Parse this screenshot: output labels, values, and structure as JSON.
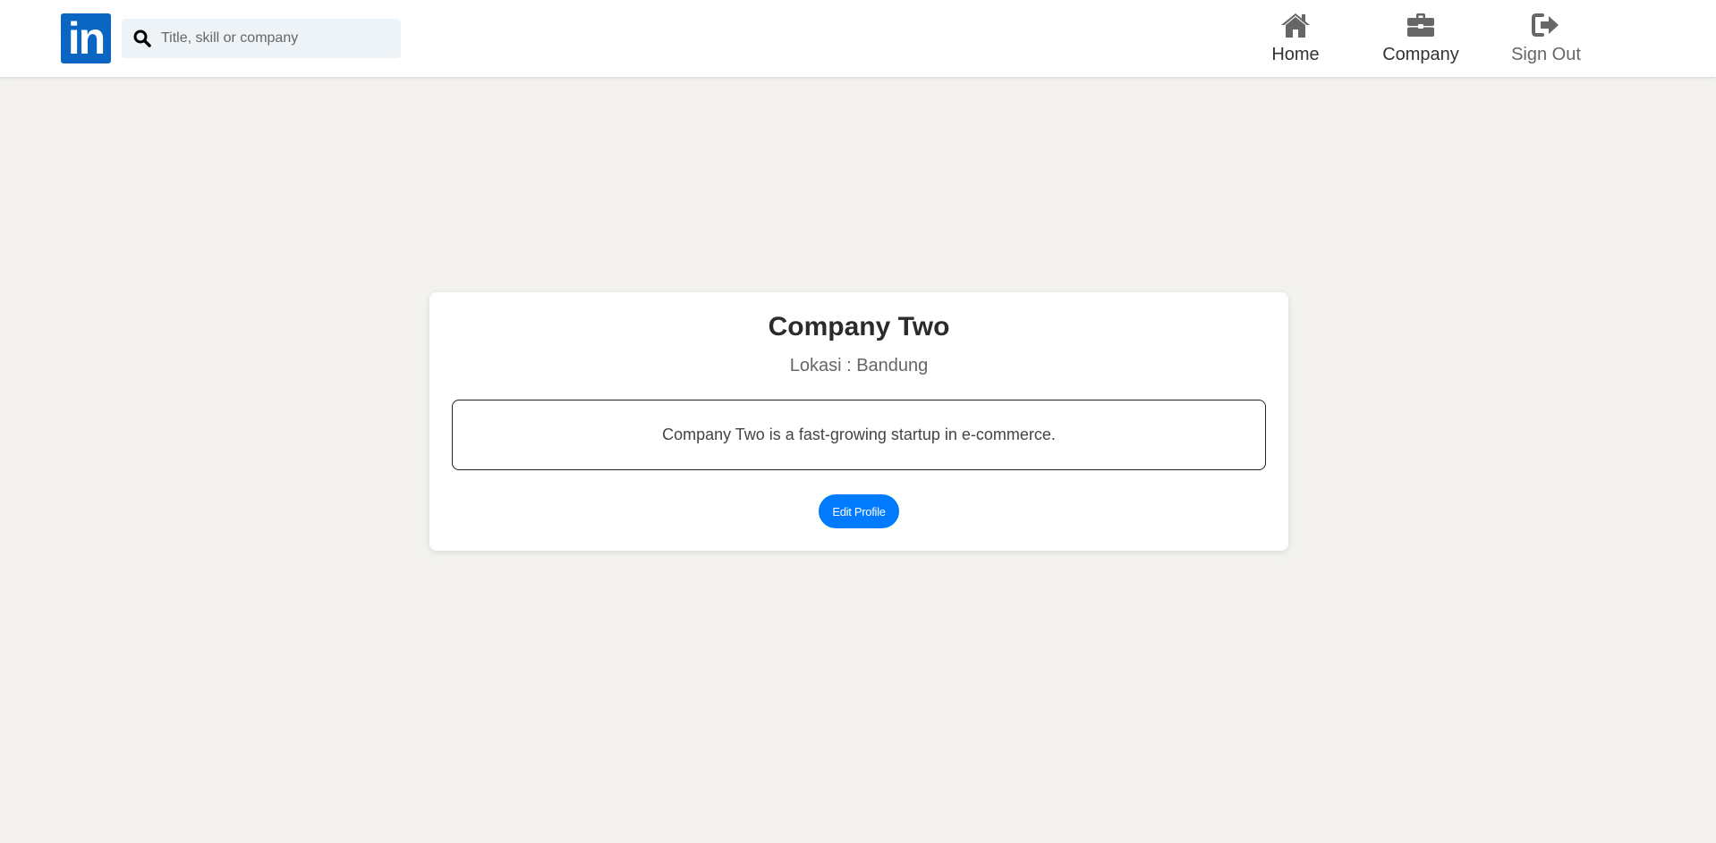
{
  "header": {
    "logo_text": "in",
    "search": {
      "placeholder": "Title, skill or company",
      "value": ""
    },
    "nav": [
      {
        "label": "Home",
        "icon": "home-icon"
      },
      {
        "label": "Company",
        "icon": "briefcase-icon"
      },
      {
        "label": "Sign Out",
        "icon": "sign-out-icon"
      }
    ]
  },
  "profile": {
    "name": "Company Two",
    "location_label": "Lokasi",
    "location_separator": ":",
    "location_value": "Bandung",
    "description": "Company Two is a fast-growing startup in e-commerce.",
    "edit_button_label": "Edit Profile"
  },
  "colors": {
    "brand": "#0a66c2",
    "button": "#007bff",
    "background": "#f3f2ef",
    "icon": "#666666"
  }
}
